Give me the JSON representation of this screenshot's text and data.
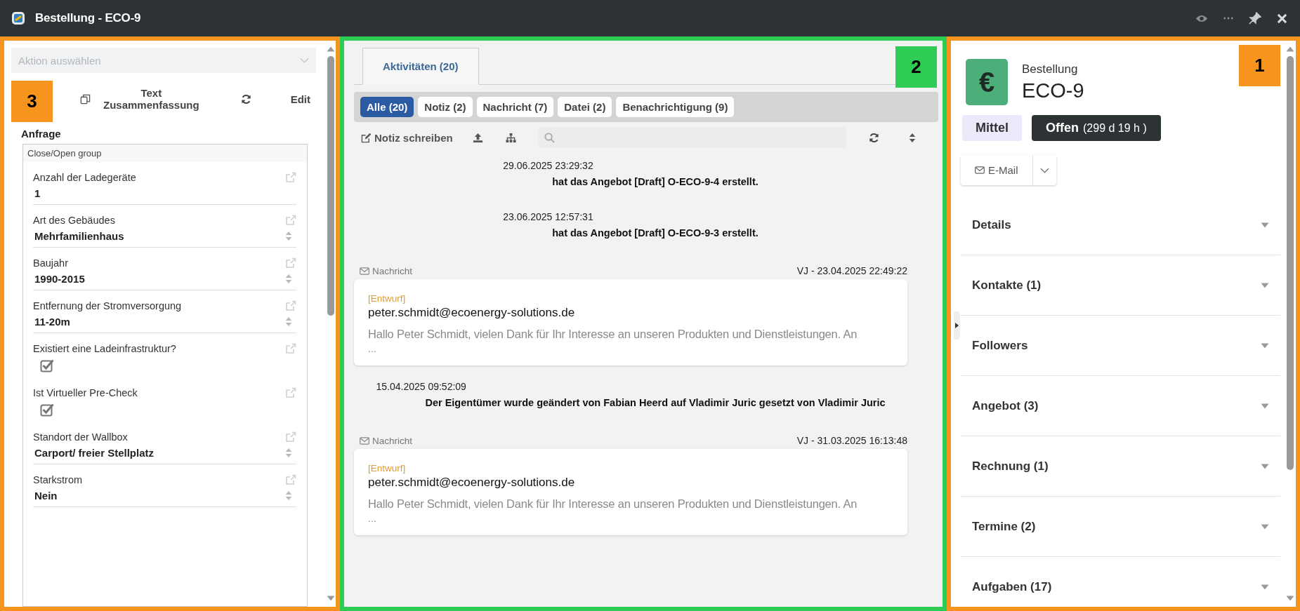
{
  "window": {
    "title": "Bestellung - ECO-9"
  },
  "request_panel": {
    "marker": "3",
    "action_select": {
      "placeholder": "Aktion auswählen"
    },
    "summary_button": "Text Zusammenfassung",
    "edit_button": "Edit",
    "section_title": "Anfrage",
    "group_toggle": "Close/Open group",
    "fields": [
      {
        "kind": "text",
        "label": "Anzahl der Ladegeräte",
        "value": "1"
      },
      {
        "kind": "select",
        "label": "Art des Gebäudes",
        "value": "Mehrfamilienhaus"
      },
      {
        "kind": "select",
        "label": "Baujahr",
        "value": "1990-2015"
      },
      {
        "kind": "select",
        "label": "Entfernung der Stromversorgung",
        "value": "11-20m"
      },
      {
        "kind": "checkbox",
        "label": "Existiert eine Ladeinfrastruktur?",
        "checked": true
      },
      {
        "kind": "checkbox",
        "label": "Ist Virtueller Pre-Check",
        "checked": true
      },
      {
        "kind": "select",
        "label": "Standort der Wallbox",
        "value": "Carport/ freier Stellplatz"
      },
      {
        "kind": "select",
        "label": "Starkstrom",
        "value": "Nein"
      }
    ]
  },
  "activity_panel": {
    "marker": "2",
    "tabs": [
      {
        "label": "Aktivitäten (20)",
        "selected": true
      }
    ],
    "filters": [
      {
        "label": "Alle (20)",
        "selected": true
      },
      {
        "label": "Notiz (2)",
        "selected": false
      },
      {
        "label": "Nachricht (7)",
        "selected": false
      },
      {
        "label": "Datei (2)",
        "selected": false
      },
      {
        "label": "Benachrichtigung (9)",
        "selected": false
      }
    ],
    "write_note": "Notiz schreiben",
    "items": [
      {
        "kind": "event",
        "timestamp": "29.06.2025 23:29:32",
        "text": "hat das Angebot [Draft] O-ECO-9-4 erstellt."
      },
      {
        "kind": "event",
        "timestamp": "23.06.2025 12:57:31",
        "text": "hat das Angebot [Draft] O-ECO-9-3 erstellt."
      },
      {
        "kind": "message",
        "type_label": "Nachricht",
        "meta": "VJ - 23.04.2025 22:49:22",
        "tag": "[Entwurf]",
        "address": "peter.schmidt@ecoenergy-solutions.de",
        "preview": "Hallo Peter Schmidt, vielen Dank für Ihr Interesse an unseren Produkten und Dienstleistungen. An",
        "ellipsis": "..."
      },
      {
        "kind": "event",
        "timestamp": "15.04.2025 09:52:09",
        "text": "Der Eigentümer wurde geändert von Fabian Heerd auf Vladimir Juric gesetzt von Vladimir Juric"
      },
      {
        "kind": "message",
        "type_label": "Nachricht",
        "meta": "VJ - 31.03.2025 16:13:48",
        "tag": "[Entwurf]",
        "address": "peter.schmidt@ecoenergy-solutions.de",
        "preview": "Hallo Peter Schmidt, vielen Dank für Ihr Interesse an unseren Produkten und Dienstleistungen. An",
        "ellipsis": "..."
      }
    ]
  },
  "detail_panel": {
    "marker": "1",
    "record_icon": "€",
    "record_type": "Bestellung",
    "record_id": "ECO-9",
    "priority": "Mittel",
    "status": {
      "label": "Offen",
      "duration": "(299 d 19 h )"
    },
    "email_button": "E-Mail",
    "sections": [
      {
        "label": "Details",
        "expanded": false
      },
      {
        "label": "Kontakte (1)",
        "expanded": false
      },
      {
        "label": "Followers",
        "expanded": false
      },
      {
        "label": "Angebot (3)",
        "expanded": false
      },
      {
        "label": "Rechnung (1)",
        "expanded": false
      },
      {
        "label": "Termine (2)",
        "expanded": false
      },
      {
        "label": "Aufgaben (17)",
        "expanded": false
      }
    ]
  }
}
